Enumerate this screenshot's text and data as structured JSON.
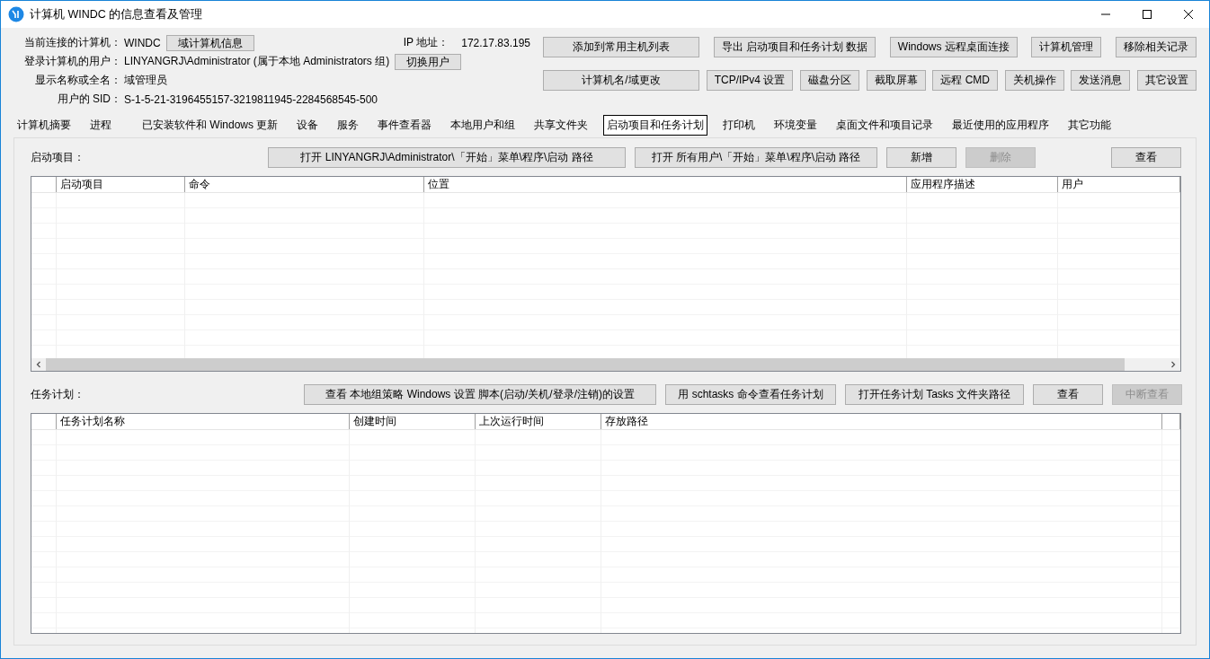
{
  "window": {
    "title": "计算机 WINDC 的信息查看及管理"
  },
  "info": {
    "rows": [
      {
        "label": "当前连接的计算机：",
        "value": "WINDC",
        "button": "域计算机信息",
        "extra_label": "IP 地址：",
        "extra_value": "172.17.83.195"
      },
      {
        "label": "登录计算机的用户：",
        "value": "LINYANGRJ\\Administrator (属于本地 Administrators 组)",
        "button": "切换用户"
      },
      {
        "label": "显示名称或全名：",
        "value": "域管理员"
      },
      {
        "label": "用户的 SID：",
        "value": "S-1-5-21-3196455157-3219811945-2284568545-500"
      }
    ]
  },
  "toolbar_rows": [
    [
      "添加到常用主机列表",
      "导出 启动项目和任务计划 数据",
      "Windows 远程桌面连接",
      "计算机管理",
      "移除相关记录"
    ],
    [
      "计算机名/域更改",
      "TCP/IPv4 设置",
      "磁盘分区",
      "截取屏幕",
      "远程 CMD",
      "关机操作",
      "发送消息",
      "其它设置"
    ]
  ],
  "tabs": [
    {
      "label": "计算机摘要",
      "selected": false
    },
    {
      "label": "进程",
      "selected": false
    },
    {
      "label": "已安装软件和 Windows 更新",
      "selected": false
    },
    {
      "label": "设备",
      "selected": false
    },
    {
      "label": "服务",
      "selected": false
    },
    {
      "label": "事件查看器",
      "selected": false
    },
    {
      "label": "本地用户和组",
      "selected": false
    },
    {
      "label": "共享文件夹",
      "selected": false
    },
    {
      "label": "启动项目和任务计划",
      "selected": true
    },
    {
      "label": "打印机",
      "selected": false
    },
    {
      "label": "环境变量",
      "selected": false
    },
    {
      "label": "桌面文件和项目记录",
      "selected": false
    },
    {
      "label": "最近使用的应用程序",
      "selected": false
    },
    {
      "label": "其它功能",
      "selected": false
    }
  ],
  "startup": {
    "label": "启动项目：",
    "buttons": [
      {
        "label": "打开 LINYANGRJ\\Administrator\\「开始」菜单\\程序\\启动 路径",
        "disabled": false
      },
      {
        "label": "打开 所有用户\\「开始」菜单\\程序\\启动 路径",
        "disabled": false
      },
      {
        "label": "新增",
        "disabled": false
      },
      {
        "label": "删除",
        "disabled": true
      },
      {
        "label": "查看",
        "disabled": false
      }
    ],
    "columns": [
      "",
      "启动项目",
      "命令",
      "位置",
      "应用程序描述",
      "用户"
    ]
  },
  "tasks": {
    "label": "任务计划：",
    "buttons": [
      {
        "label": "查看 本地组策略 Windows 设置 脚本(启动/关机/登录/注销)的设置",
        "disabled": false
      },
      {
        "label": "用 schtasks 命令查看任务计划",
        "disabled": false
      },
      {
        "label": "打开任务计划 Tasks 文件夹路径",
        "disabled": false
      },
      {
        "label": "查看",
        "disabled": false
      },
      {
        "label": "中断查看",
        "disabled": true
      }
    ],
    "columns": [
      "",
      "任务计划名称",
      "创建时间",
      "上次运行时间",
      "存放路径",
      ""
    ]
  }
}
